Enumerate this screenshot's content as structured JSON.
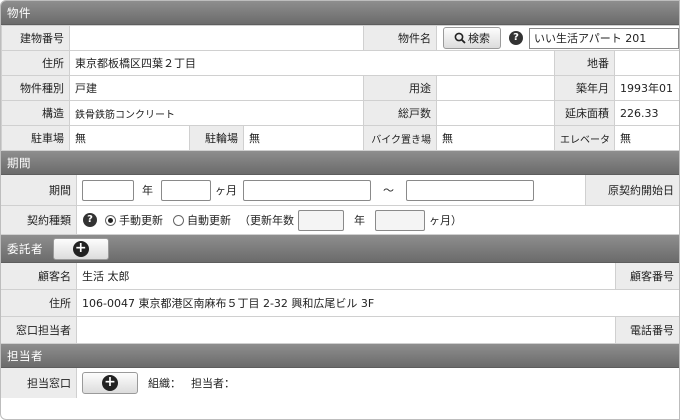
{
  "property": {
    "header": "物件",
    "building_no_label": "建物番号",
    "building_no_value": "",
    "name_label": "物件名",
    "search_label": "検索",
    "name_select_value": "いい生活アパート 201",
    "address_label": "住所",
    "address_value": "東京都板橋区四葉２丁目",
    "lot_label": "地番",
    "lot_value": "",
    "type_label": "物件種別",
    "type_value": "戸建",
    "usage_label": "用途",
    "usage_value": "",
    "built_label": "築年月",
    "built_value": "1993年01",
    "structure_label": "構造",
    "structure_value": "鉄骨鉄筋コンクリート",
    "units_label": "総戸数",
    "units_value": "",
    "floor_area_label": "延床面積",
    "floor_area_value": "226.33",
    "parking_label": "駐車場",
    "parking_value": "無",
    "bicycle_label": "駐輪場",
    "bicycle_value": "無",
    "bike_label": "バイク置き場",
    "bike_value": "無",
    "elevator_label": "エレベータ",
    "elevator_value": "無"
  },
  "period": {
    "header": "期間",
    "period_label": "期間",
    "year_unit": "年",
    "month_unit": "ヶ月",
    "tilde": "～",
    "orig_start_label": "原契約開始日",
    "contract_type_label": "契約種類",
    "manual_label": "手動更新",
    "auto_label": "自動更新",
    "renewal_prefix": "（更新年数",
    "renewal_year_unit": "年",
    "renewal_month_unit": "ヶ月）",
    "selected_type": "手動更新"
  },
  "consignor": {
    "header": "委託者",
    "client_name_label": "顧客名",
    "client_name_value": "生活 太郎",
    "client_no_label": "顧客番号",
    "address_label": "住所",
    "address_value": "106-0047 東京都港区南麻布５丁目 2-32 興和広尾ビル 3F",
    "contact_label": "窓口担当者",
    "contact_value": "",
    "phone_label": "電話番号"
  },
  "staff": {
    "header": "担当者",
    "window_label": "担当窓口",
    "org_label": "組織：",
    "person_label": "担当者："
  }
}
